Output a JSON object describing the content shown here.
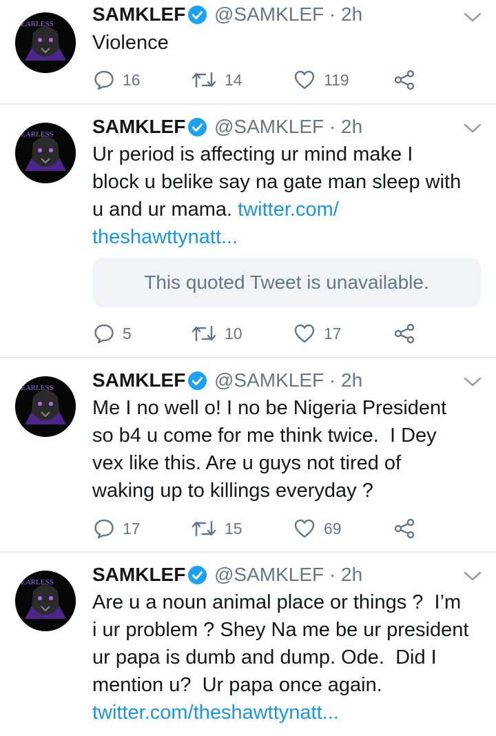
{
  "tweets": [
    {
      "author": "SAMKLEF",
      "handle_time": "@SAMKLEF · 2h",
      "text": "Violence",
      "link": "",
      "quote": "",
      "replies": "16",
      "retweets": "14",
      "likes": "119",
      "avatar_text": "FEARLESS"
    },
    {
      "author": "SAMKLEF",
      "handle_time": "@SAMKLEF · 2h",
      "text": "Ur period is affecting ur mind make I\nblock u belike say na gate man sleep with\nu and ur mama. ",
      "link": "twitter.com/\ntheshawttynatt...",
      "quote": "This quoted Tweet is unavailable.",
      "replies": "5",
      "retweets": "10",
      "likes": "17",
      "avatar_text": "FEARLESS"
    },
    {
      "author": "SAMKLEF",
      "handle_time": "@SAMKLEF · 2h",
      "text": "Me I no well o! I no be Nigeria President\nso b4 u come for me think twice.  I Dey\nvex like this. Are u guys not tired of\nwaking up to killings everyday ?",
      "link": "",
      "quote": "",
      "replies": "17",
      "retweets": "15",
      "likes": "69",
      "avatar_text": "FEARLESS"
    },
    {
      "author": "SAMKLEF",
      "handle_time": "@SAMKLEF · 2h",
      "text": "Are u a noun animal place or things ?  I’m\ni ur problem ? Shey Na me be ur president\nur papa is dumb and dump. Ode.  Did I\nmention u?  Ur papa once again.\n",
      "link": "twitter.com/theshawttynatt...",
      "quote": "",
      "replies": "",
      "retweets": "",
      "likes": "",
      "avatar_text": "FEARLESS"
    }
  ],
  "colors": {
    "text": "#14171a",
    "secondary": "#657786",
    "link": "#1b95e0",
    "verified": "#1da1f2",
    "divider": "#e6ecf0",
    "quote_bg": "#f0f4f7",
    "avatar_accent": "#7b3fd0"
  },
  "icons": {
    "verified": "verified-badge-icon",
    "chevron": "chevron-down-icon",
    "reply": "reply-icon",
    "retweet": "retweet-icon",
    "like": "heart-icon",
    "share": "share-icon"
  }
}
